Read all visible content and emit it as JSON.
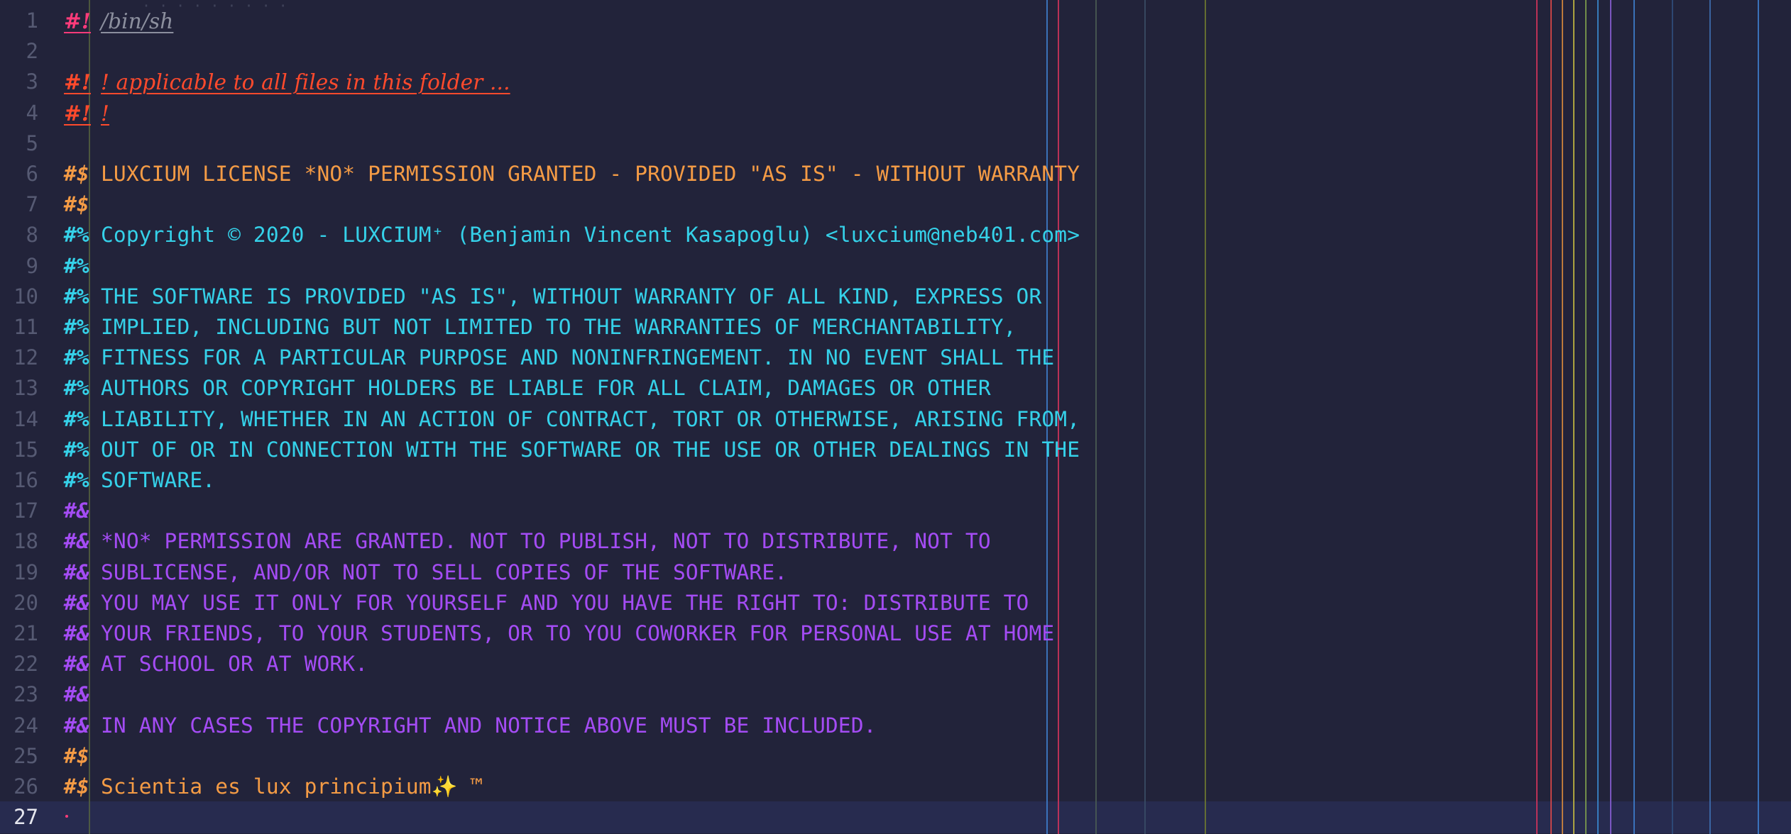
{
  "editor": {
    "header_fragment": "· · · · · · · · ·",
    "current_line": 27,
    "colors": {
      "background": "#22233a",
      "current_line_bg": "#272b4f",
      "line_number": "#565a73",
      "line_number_current": "#e6e7ef",
      "shebang_hash": "#ff3b7a",
      "shebang_path": "#8c8f9e",
      "header_red": "#ff4a2c",
      "license_orange": "#f49b45",
      "license_cyan": "#35d1e9",
      "license_purple": "#a44cf4"
    },
    "ruler_colors": [
      "#3e7fcf",
      "#d6345c",
      "#4b5d54",
      "#3a4d66",
      "#6e7a2f",
      "#d6345c",
      "#e04949",
      "#d78a3c",
      "#c4b941",
      "#7fa04c",
      "#3a8bd1",
      "#8b5fd6",
      "#3e7fcf",
      "#2f4d7c",
      "#3e6fb0",
      "#3e7fcf"
    ]
  },
  "lines": [
    {
      "n": "1",
      "prefix": "#!",
      "text": "/bin/sh",
      "style": "shebang"
    },
    {
      "n": "2",
      "prefix": "",
      "text": "",
      "style": "blank"
    },
    {
      "n": "3",
      "prefix": "#!",
      "text": "! applicable to all files in this folder ...",
      "style": "red"
    },
    {
      "n": "4",
      "prefix": "#!",
      "text": "!",
      "style": "red"
    },
    {
      "n": "5",
      "prefix": "",
      "text": "",
      "style": "blank"
    },
    {
      "n": "6",
      "prefix": "#$",
      "text": "LUXCIUM LICENSE *NO* PERMISSION GRANTED - PROVIDED \"AS IS\" - WITHOUT WARRANTY",
      "style": "orange"
    },
    {
      "n": "7",
      "prefix": "#$",
      "text": "",
      "style": "orange"
    },
    {
      "n": "8",
      "prefix": "#%",
      "text": "Copyright © 2020 - LUXCIUM⁺ (Benjamin Vincent Kasapoglu) <luxcium@neb401.com>",
      "style": "cyan"
    },
    {
      "n": "9",
      "prefix": "#%",
      "text": "",
      "style": "cyan"
    },
    {
      "n": "10",
      "prefix": "#%",
      "text": "THE SOFTWARE IS PROVIDED \"AS IS\", WITHOUT WARRANTY OF ALL KIND, EXPRESS OR",
      "style": "cyan"
    },
    {
      "n": "11",
      "prefix": "#%",
      "text": "IMPLIED, INCLUDING BUT NOT LIMITED TO THE WARRANTIES OF MERCHANTABILITY,",
      "style": "cyan"
    },
    {
      "n": "12",
      "prefix": "#%",
      "text": "FITNESS FOR A PARTICULAR PURPOSE AND NONINFRINGEMENT. IN NO EVENT SHALL THE",
      "style": "cyan"
    },
    {
      "n": "13",
      "prefix": "#%",
      "text": "AUTHORS OR COPYRIGHT HOLDERS BE LIABLE FOR ALL CLAIM, DAMAGES OR OTHER",
      "style": "cyan"
    },
    {
      "n": "14",
      "prefix": "#%",
      "text": "LIABILITY, WHETHER IN AN ACTION OF CONTRACT, TORT OR OTHERWISE, ARISING FROM,",
      "style": "cyan"
    },
    {
      "n": "15",
      "prefix": "#%",
      "text": "OUT OF OR IN CONNECTION WITH THE SOFTWARE OR THE USE OR OTHER DEALINGS IN THE",
      "style": "cyan"
    },
    {
      "n": "16",
      "prefix": "#%",
      "text": "SOFTWARE.",
      "style": "cyan"
    },
    {
      "n": "17",
      "prefix": "#&",
      "text": "",
      "style": "purple"
    },
    {
      "n": "18",
      "prefix": "#&",
      "text": "*NO* PERMISSION ARE GRANTED. NOT TO PUBLISH, NOT TO DISTRIBUTE, NOT TO",
      "style": "purple"
    },
    {
      "n": "19",
      "prefix": "#&",
      "text": "SUBLICENSE, AND/OR NOT TO SELL COPIES OF THE SOFTWARE.",
      "style": "purple"
    },
    {
      "n": "20",
      "prefix": "#&",
      "text": "YOU MAY USE IT ONLY FOR YOURSELF AND YOU HAVE THE RIGHT TO: DISTRIBUTE TO",
      "style": "purple"
    },
    {
      "n": "21",
      "prefix": "#&",
      "text": "YOUR FRIENDS, TO YOUR STUDENTS, OR TO YOU COWORKER FOR PERSONAL USE AT HOME",
      "style": "purple"
    },
    {
      "n": "22",
      "prefix": "#&",
      "text": "AT SCHOOL OR AT WORK.",
      "style": "purple"
    },
    {
      "n": "23",
      "prefix": "#&",
      "text": "",
      "style": "purple"
    },
    {
      "n": "24",
      "prefix": "#&",
      "text": "IN ANY CASES THE COPYRIGHT AND NOTICE ABOVE MUST BE INCLUDED.",
      "style": "purple"
    },
    {
      "n": "25",
      "prefix": "#$",
      "text": "",
      "style": "orange"
    },
    {
      "n": "26",
      "prefix": "#$",
      "text": "Scientia es lux principium✨ ™",
      "style": "orange"
    },
    {
      "n": "27",
      "prefix": "",
      "text": "",
      "style": "current"
    }
  ]
}
